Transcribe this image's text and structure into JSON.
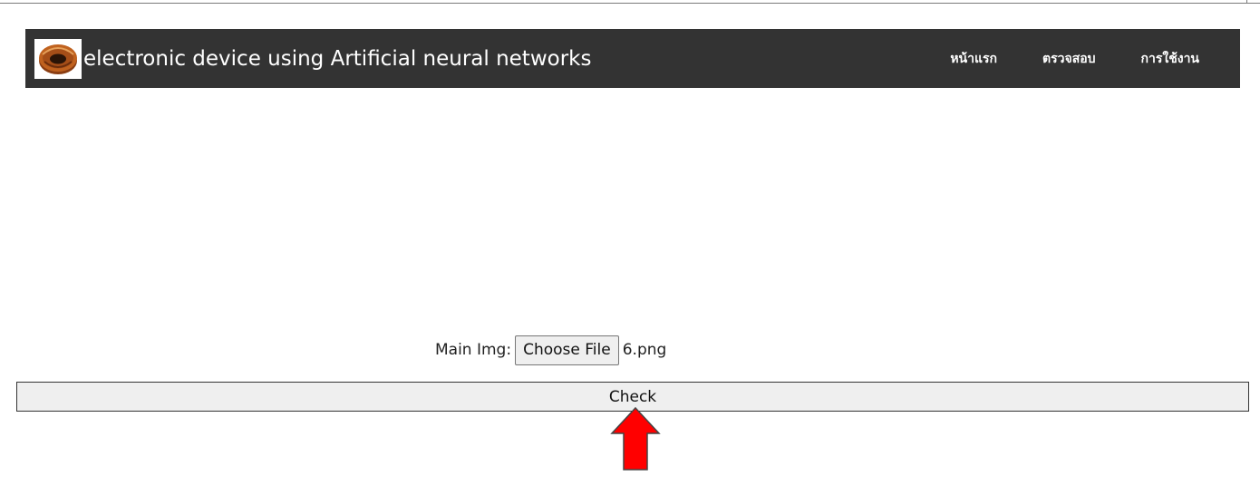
{
  "navbar": {
    "brand_title": "electronic device using Artificial neural networks",
    "logo_icon": "toroidal-inductor-icon",
    "bg_color": "#333333",
    "items": [
      {
        "label": "หน้าแรก"
      },
      {
        "label": "ตรวจสอบ"
      },
      {
        "label": "การใช้งาน"
      }
    ]
  },
  "upload": {
    "label": "Main Img:",
    "button_label": "Choose File",
    "file_name": "6.png"
  },
  "check_button": {
    "label": "Check"
  },
  "annotation": {
    "icon": "red-up-arrow-icon",
    "color": "#ff0000"
  }
}
